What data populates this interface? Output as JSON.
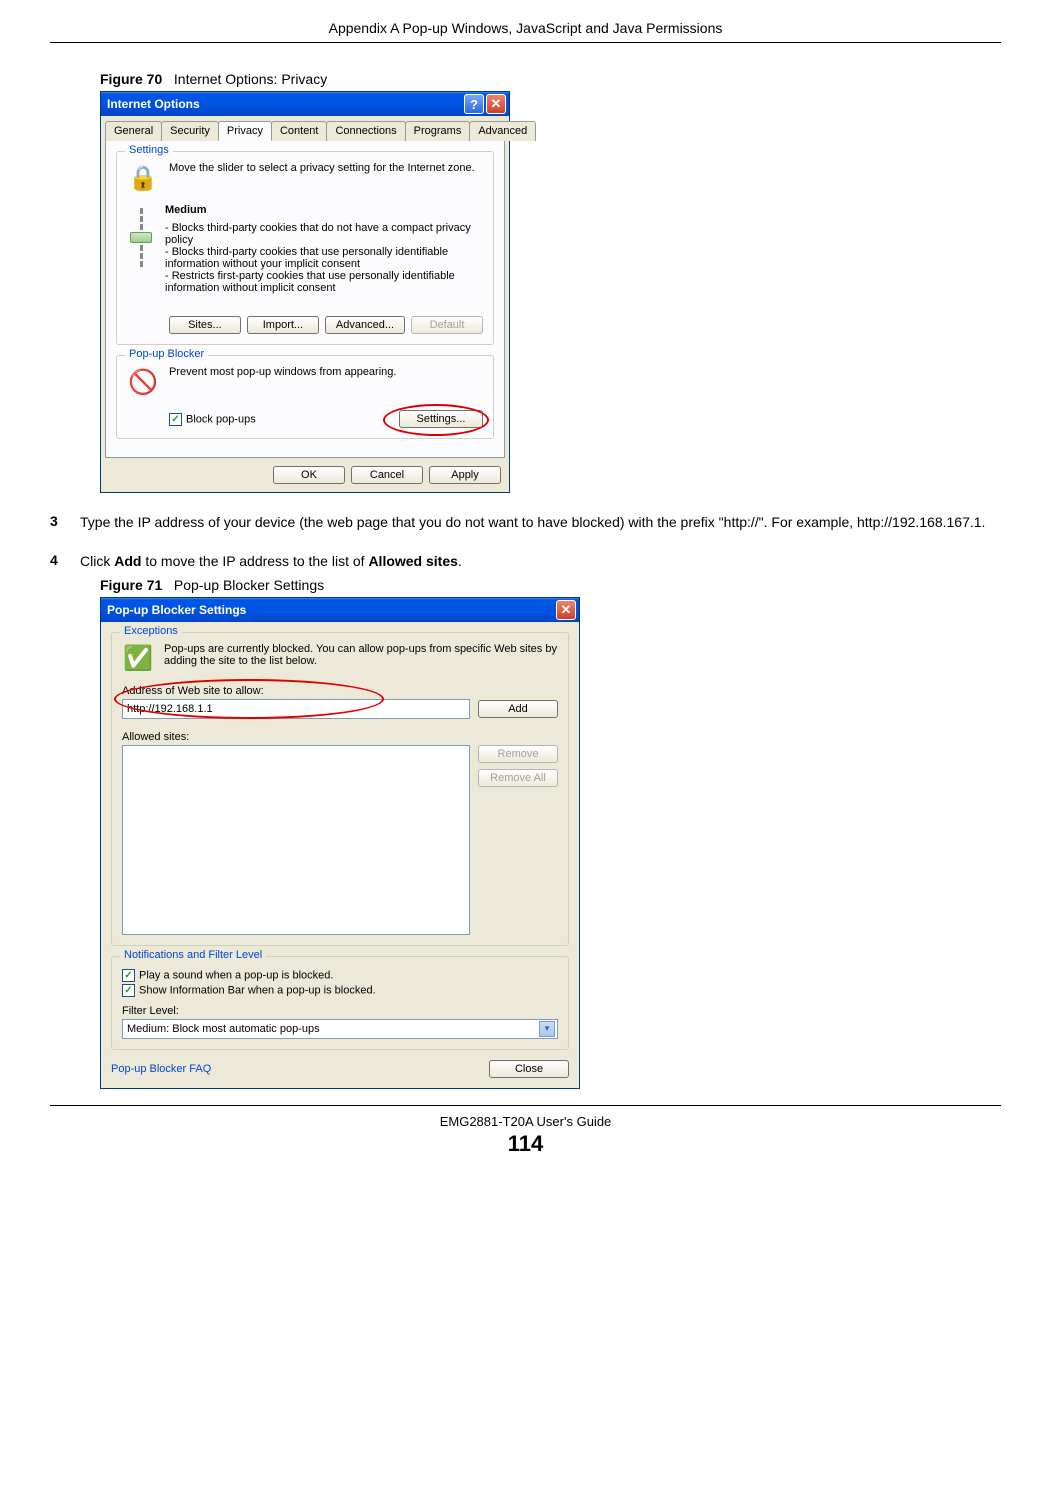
{
  "header": "Appendix A Pop-up Windows, JavaScript and Java Permissions",
  "fig70": {
    "num": "Figure 70",
    "title": "Internet Options: Privacy"
  },
  "step3": {
    "n": "3",
    "text": "Type the IP address of your device (the web page that you do not want to have blocked) with the prefix \"http://\". For example, http://192.168.167.1."
  },
  "step4": {
    "n": "4",
    "pre": "Click ",
    "b1": "Add",
    "mid": " to move the IP address to the list of ",
    "b2": "Allowed sites",
    "post": "."
  },
  "fig71": {
    "num": "Figure 71",
    "title": "Pop-up Blocker Settings"
  },
  "footer": {
    "guide": "EMG2881-T20A User's Guide",
    "page": "114"
  },
  "io": {
    "title": "Internet Options",
    "tabs": [
      "General",
      "Security",
      "Privacy",
      "Content",
      "Connections",
      "Programs",
      "Advanced"
    ],
    "settingsGroup": "Settings",
    "settingsDesc": "Move the slider to select a privacy setting for the Internet zone.",
    "level": "Medium",
    "bullets": [
      "- Blocks third-party cookies that do not have a compact privacy policy",
      "- Blocks third-party cookies that use personally identifiable information without your implicit consent",
      "- Restricts first-party cookies that use personally identifiable information without implicit consent"
    ],
    "sites": "Sites...",
    "import": "Import...",
    "advanced": "Advanced...",
    "default": "Default",
    "popGroup": "Pop-up Blocker",
    "popDesc": "Prevent most pop-up windows from appearing.",
    "blockpop": "Block pop-ups",
    "settingsBtn": "Settings...",
    "ok": "OK",
    "cancel": "Cancel",
    "apply": "Apply"
  },
  "pb": {
    "title": "Pop-up Blocker Settings",
    "excGroup": "Exceptions",
    "excDesc": "Pop-ups are currently blocked.  You can allow pop-ups from specific Web sites by adding the site to the list below.",
    "addrLabel": "Address of Web site to allow:",
    "addrValue": "http://192.168.1.1",
    "add": "Add",
    "allowedLabel": "Allowed sites:",
    "remove": "Remove",
    "removeAll": "Remove All",
    "notifGroup": "Notifications and Filter Level",
    "n1": "Play a sound when a pop-up is blocked.",
    "n2": "Show Information Bar when a pop-up is blocked.",
    "filterLabel": "Filter Level:",
    "filterValue": "Medium: Block most automatic pop-ups",
    "faq": "Pop-up Blocker FAQ",
    "close": "Close"
  }
}
